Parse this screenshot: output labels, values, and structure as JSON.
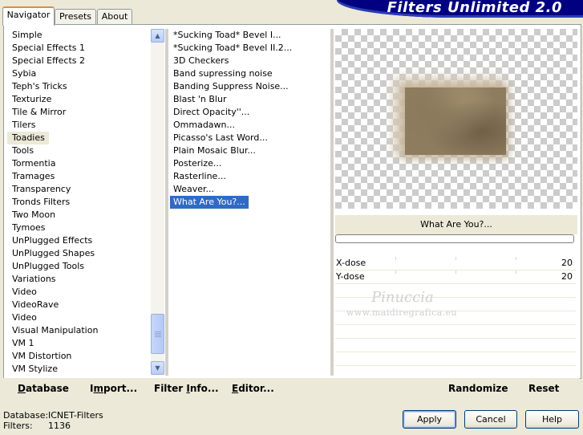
{
  "tabs": [
    {
      "label": "Navigator",
      "active": true
    },
    {
      "label": "Presets",
      "active": false
    },
    {
      "label": "About",
      "active": false
    }
  ],
  "app_title": "Filters Unlimited 2.0",
  "categories": {
    "items": [
      "Simple",
      "Special Effects 1",
      "Special Effects 2",
      "Sybia",
      "Teph's Tricks",
      "Texturize",
      "Tile & Mirror",
      "Tilers",
      "Toadies",
      "Tools",
      "Tormentia",
      "Tramages",
      "Transparency",
      "Tronds Filters",
      "Two Moon",
      "Tymoes",
      "UnPlugged Effects",
      "UnPlugged Shapes",
      "UnPlugged Tools",
      "Variations",
      "Video",
      "VideoRave",
      "Video",
      "Visual Manipulation",
      "VM 1",
      "VM Distortion",
      "VM Stylize"
    ],
    "selected": "Toadies"
  },
  "filters": {
    "items": [
      "*Sucking Toad*  Bevel I...",
      "*Sucking Toad*  Bevel II.2...",
      "3D Checkers",
      "Band supressing noise",
      "Banding Suppress Noise...",
      "Blast 'n Blur",
      "Direct Opacity''...",
      "Ommadawn...",
      "Picasso's Last Word...",
      "Plain Mosaic Blur...",
      "Posterize...",
      "Rasterline...",
      "Weaver...",
      "What Are You?..."
    ],
    "selected": "What Are You?..."
  },
  "preview": {
    "filter_name": "What Are You?...",
    "progress": 0
  },
  "params": [
    {
      "label": "X-dose",
      "value": "20"
    },
    {
      "label": "Y-dose",
      "value": "20"
    }
  ],
  "watermark": {
    "title": "Pinuccia",
    "url": "www.maidiregrafica.eu"
  },
  "bottom_buttons": {
    "database": {
      "u": "D",
      "rest": "atabase"
    },
    "import": {
      "pre": "I",
      "u": "m",
      "rest": "port..."
    },
    "filter_info": {
      "pre": "Filter ",
      "u": "I",
      "rest": "nfo..."
    },
    "editor": {
      "u": "E",
      "rest": "ditor..."
    },
    "randomize": "Randomize",
    "reset": "Reset"
  },
  "footer": {
    "database_label": "Database:",
    "database_value": "ICNET-Filters",
    "filters_label": "Filters:",
    "filters_value": "1136",
    "apply": "Apply",
    "cancel": "Cancel",
    "help": "Help"
  },
  "colors": {
    "banner": "#000080",
    "selection": "#316ac5",
    "tab_accent": "#e68b2c"
  }
}
